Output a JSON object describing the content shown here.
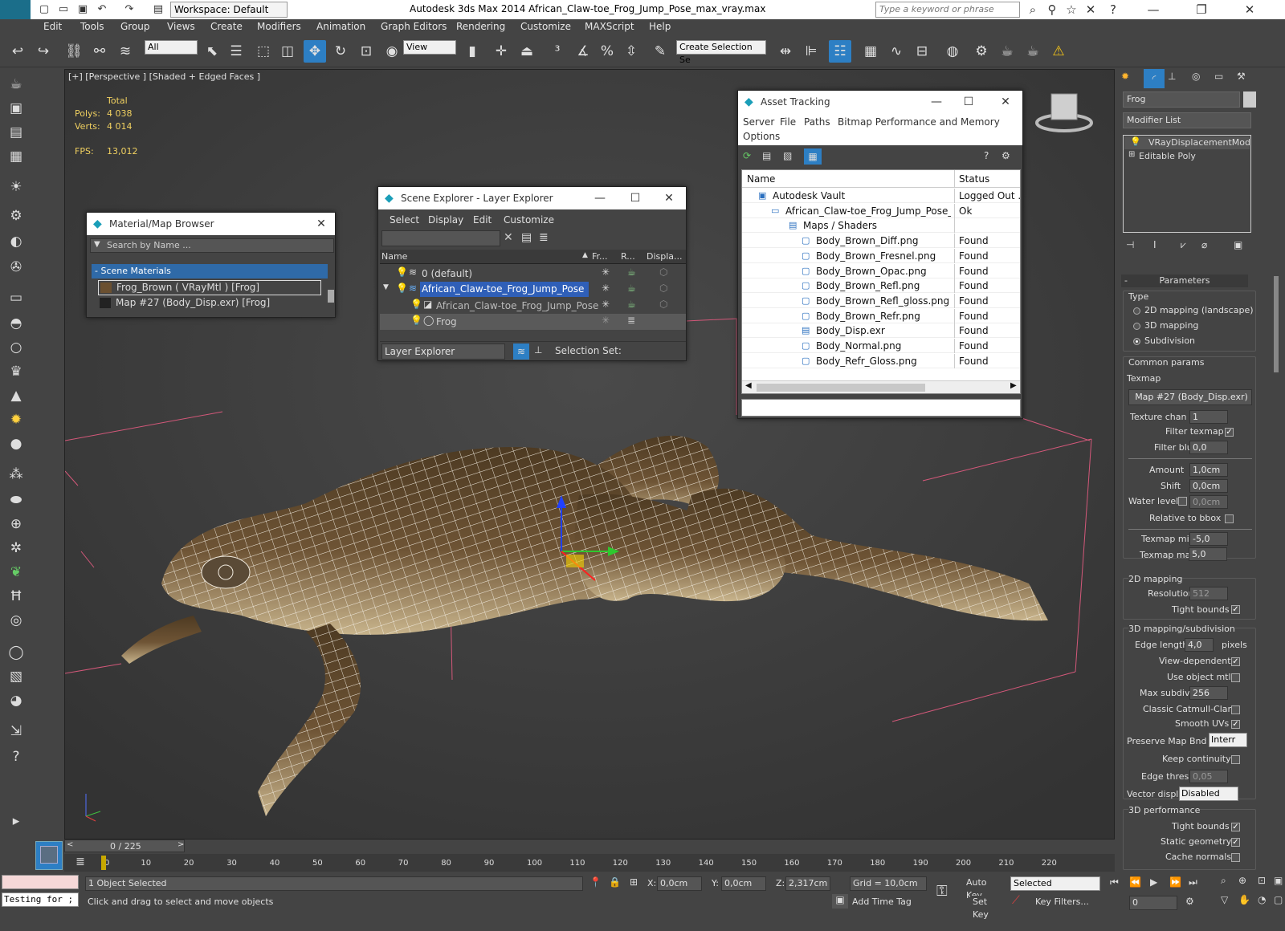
{
  "app": {
    "title": "Autodesk 3ds Max  2014    African_Claw-toe_Frog_Jump_Pose_max_vray.max",
    "logo": "MAX",
    "workspace": "Workspace: Default",
    "search_placeholder": "Type a keyword or phrase"
  },
  "menu": [
    "Edit",
    "Tools",
    "Group",
    "Views",
    "Create",
    "Modifiers",
    "Animation",
    "Graph Editors",
    "Rendering",
    "Customize",
    "MAXScript",
    "Help"
  ],
  "toolbar": {
    "filter": "All",
    "refcoord": "View",
    "selection_set": "Create Selection Se"
  },
  "viewport": {
    "label": "[+] [Perspective ] [Shaded + Edged Faces ]",
    "stats": {
      "total": "Total",
      "polys_label": "Polys:",
      "polys": "4 038",
      "verts_label": "Verts:",
      "verts": "4 014",
      "fps_label": "FPS:",
      "fps": "13,012"
    }
  },
  "material_browser": {
    "title": "Material/Map Browser",
    "search": "Search by Name ...",
    "group": "- Scene Materials",
    "items": [
      "Frog_Brown  ( VRayMtl )  [Frog]",
      "Map #27 (Body_Disp.exr)  [Frog]"
    ]
  },
  "scene_explorer": {
    "title": "Scene Explorer - Layer Explorer",
    "menu": [
      "Select",
      "Display",
      "Edit",
      "Customize"
    ],
    "columns": [
      "Name",
      "Fr...",
      "R...",
      "Displa..."
    ],
    "rows": [
      "0 (default)",
      "African_Claw-toe_Frog_Jump_Pose",
      "African_Claw-toe_Frog_Jump_Pose",
      "Frog"
    ],
    "footer_mode": "Layer Explorer",
    "footer_selset": "Selection Set:"
  },
  "asset_tracking": {
    "title": "Asset Tracking",
    "menu": [
      "Server",
      "File",
      "Paths",
      "Bitmap Performance and Memory"
    ],
    "menu2": "Options",
    "columns": [
      "Name",
      "Status"
    ],
    "rows": [
      {
        "name": "Autodesk Vault",
        "status": "Logged Out ..."
      },
      {
        "name": "African_Claw-toe_Frog_Jump_Pose_m...",
        "status": "Ok"
      },
      {
        "name": "Maps / Shaders",
        "status": ""
      },
      {
        "name": "Body_Brown_Diff.png",
        "status": "Found"
      },
      {
        "name": "Body_Brown_Fresnel.png",
        "status": "Found"
      },
      {
        "name": "Body_Brown_Opac.png",
        "status": "Found"
      },
      {
        "name": "Body_Brown_Refl.png",
        "status": "Found"
      },
      {
        "name": "Body_Brown_Refl_gloss.png",
        "status": "Found"
      },
      {
        "name": "Body_Brown_Refr.png",
        "status": "Found"
      },
      {
        "name": "Body_Disp.exr",
        "status": "Found"
      },
      {
        "name": "Body_Normal.png",
        "status": "Found"
      },
      {
        "name": "Body_Refr_Gloss.png",
        "status": "Found"
      }
    ]
  },
  "command_panel": {
    "object_name": "Frog",
    "modifier_list": "Modifier List",
    "stack": [
      "VRayDisplacementMod",
      "Editable Poly"
    ],
    "rollout": "Parameters",
    "type_label": "Type",
    "types": [
      "2D mapping (landscape)",
      "3D mapping",
      "Subdivision"
    ],
    "common_label": "Common params",
    "texmap_label": "Texmap",
    "texmap": "Map #27 (Body_Disp.exr)",
    "texture_chan_label": "Texture chan",
    "texture_chan": "1",
    "filter_texmap": "Filter texmap",
    "filter_blur_label": "Filter blur",
    "filter_blur": "0,0",
    "amount_label": "Amount",
    "amount": "1,0cm",
    "shift_label": "Shift",
    "shift": "0,0cm",
    "water_label": "Water level",
    "water": "0,0cm",
    "relative": "Relative to bbox",
    "texmap_min_label": "Texmap min",
    "texmap_min": "-5,0",
    "texmap_max_label": "Texmap max",
    "texmap_max": "5,0",
    "map2d_label": "2D mapping",
    "resolution_label": "Resolution",
    "resolution": "512",
    "tight_bounds": "Tight bounds",
    "map3d_label": "3D mapping/subdivision",
    "edge_length_label": "Edge length",
    "edge_length": "4,0",
    "pixels": "pixels",
    "view_dependent": "View-dependent",
    "use_object_mtl": "Use object mtl",
    "max_subdivs_label": "Max subdivs",
    "max_subdivs": "256",
    "classic": "Classic Catmull-Clark",
    "smooth_uvs": "Smooth UVs",
    "preserve_label": "Preserve Map Bnd",
    "preserve": "Interr",
    "keep_continuity": "Keep continuity",
    "edge_thresh_label": "Edge thresh",
    "edge_thresh": "0,05",
    "vector_label": "Vector displ",
    "vector": "Disabled",
    "perf_label": "3D performance",
    "perf_tight": "Tight bounds",
    "static_geo": "Static geometry",
    "cache_normals": "Cache normals"
  },
  "timeline": {
    "frame": "0 / 225",
    "ticks": [
      "0",
      "10",
      "20",
      "30",
      "40",
      "50",
      "60",
      "70",
      "80",
      "90",
      "100",
      "110",
      "120",
      "130",
      "140",
      "150",
      "160",
      "170",
      "180",
      "190",
      "200",
      "210",
      "220"
    ]
  },
  "status": {
    "script": "Testing for ;",
    "selected": "1 Object Selected",
    "prompt": "Click and drag to select and move objects",
    "x_label": "X:",
    "x": "0,0cm",
    "y_label": "Y:",
    "y": "0,0cm",
    "z_label": "Z:",
    "z": "2,317cm",
    "grid": "Grid = 10,0cm",
    "auto_key": "Auto Key",
    "set_key": "Set Key",
    "selected_mode": "Selected",
    "key_filters": "Key Filters...",
    "add_time_tag": "Add Time Tag",
    "frame_field": "0"
  }
}
